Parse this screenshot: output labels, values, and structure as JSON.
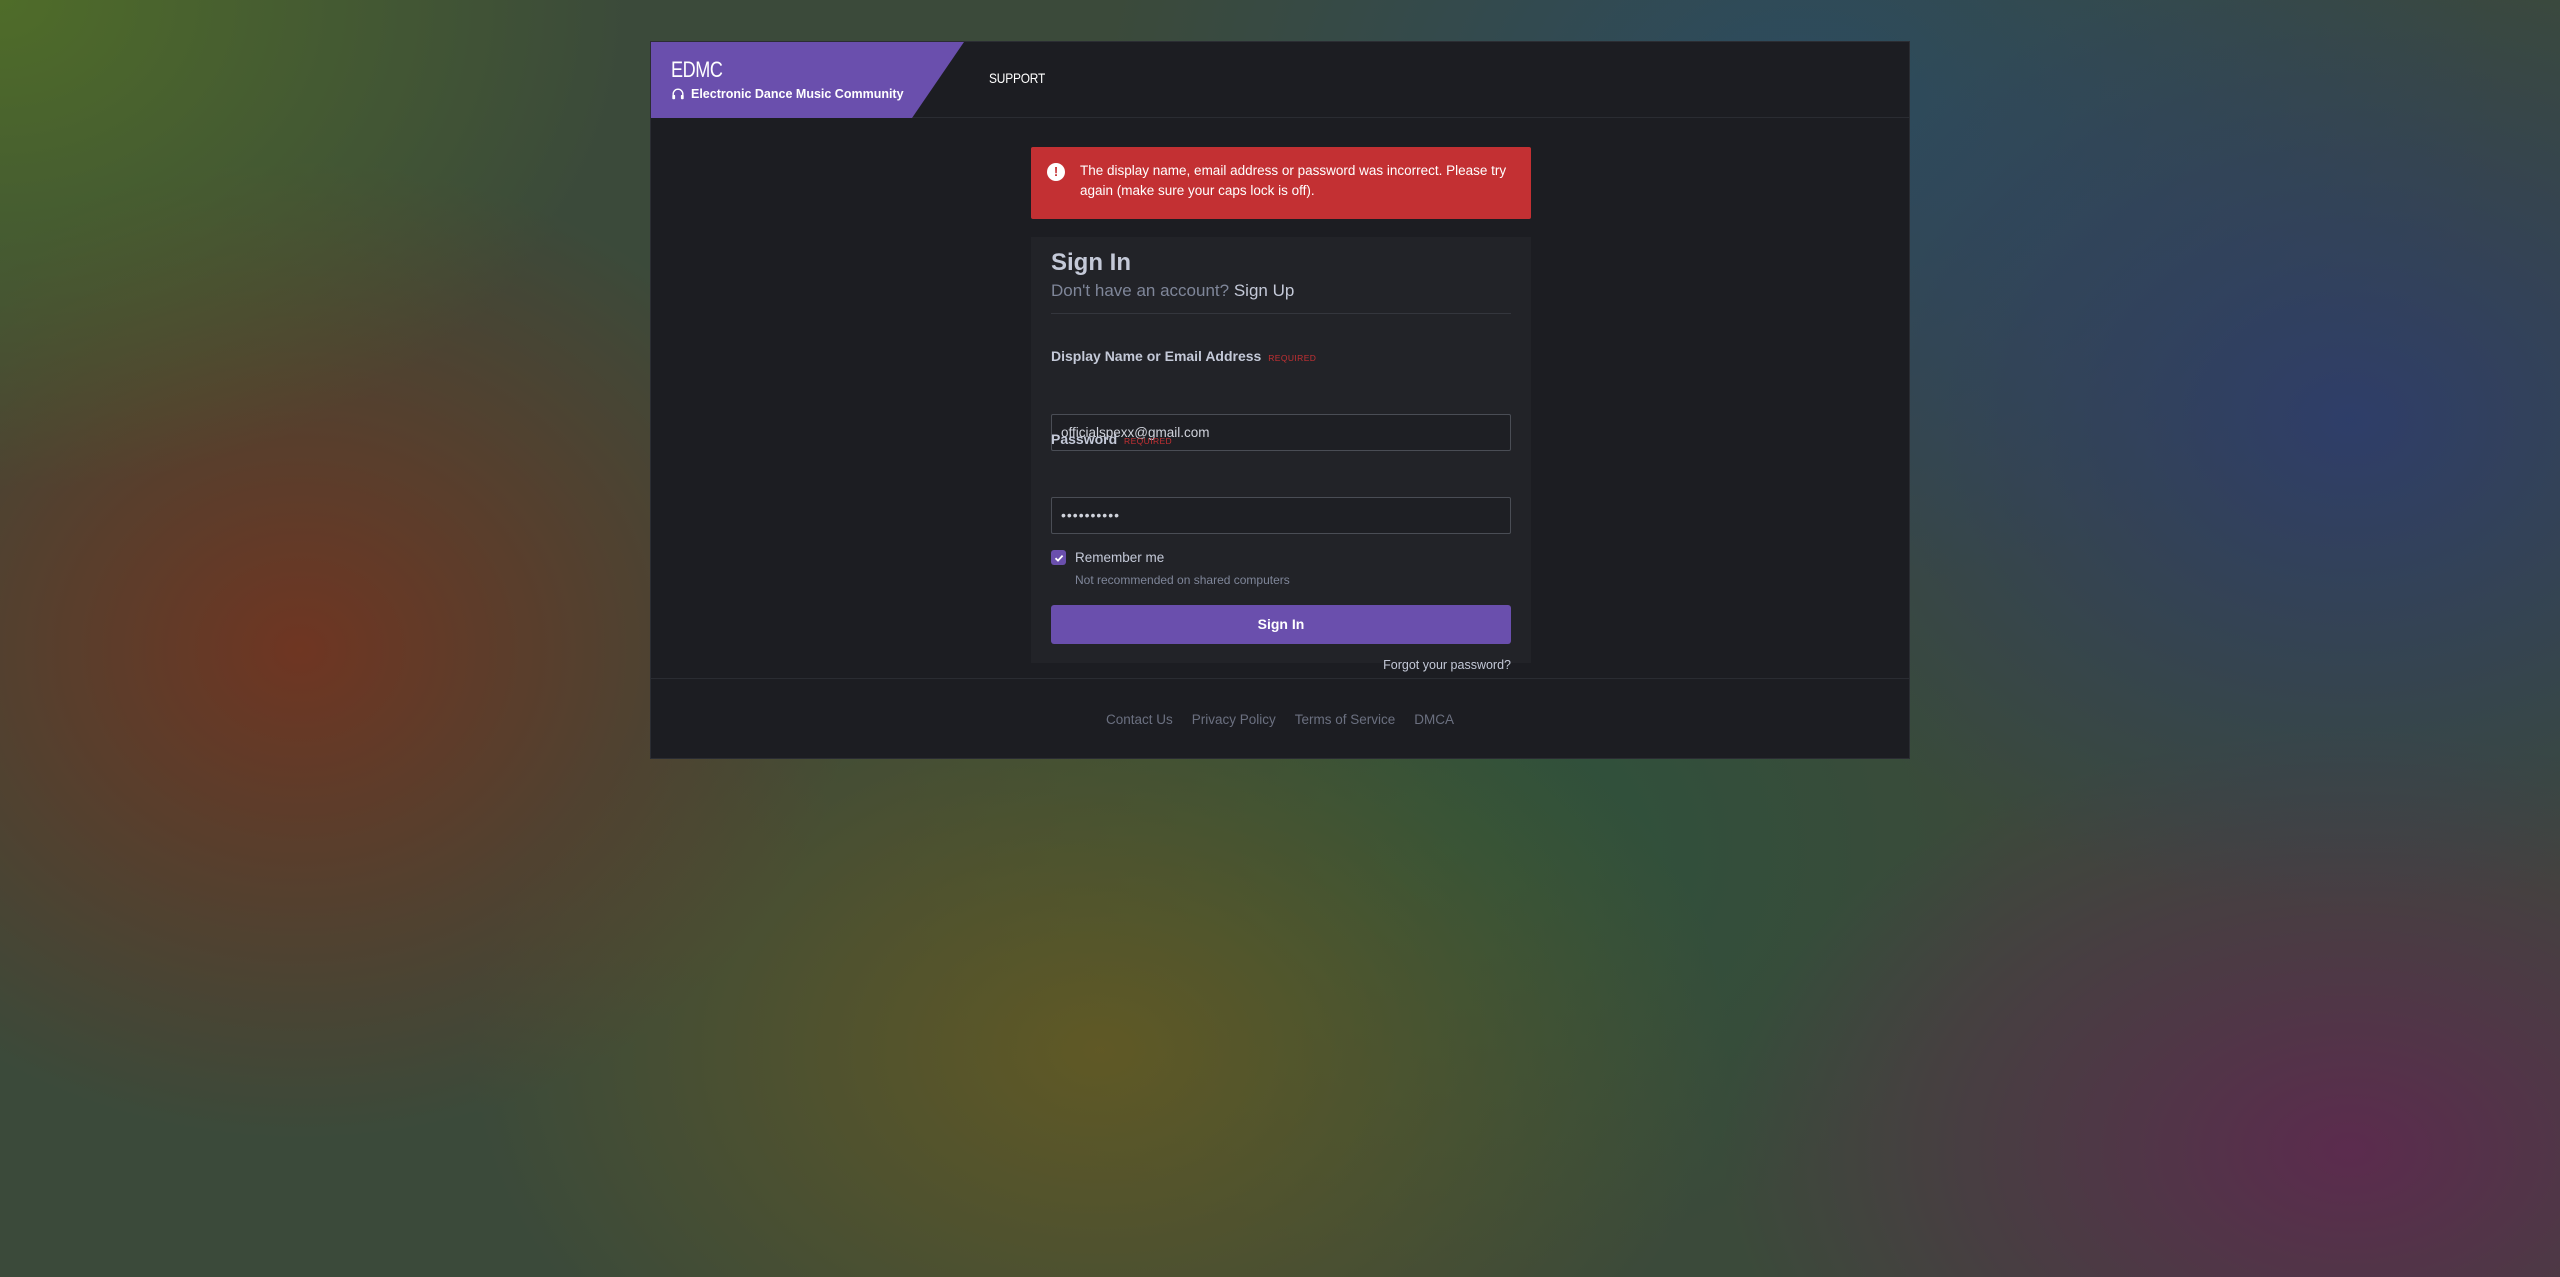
{
  "header": {
    "brand_name": "EDMC",
    "brand_subtitle": "Electronic Dance Music Community",
    "brand_icon": "headphones-icon",
    "nav_support": "SUPPORT"
  },
  "alert": {
    "icon": "exclamation-circle-icon",
    "message": "The display name, email address or password was incorrect. Please try again (make sure your caps lock is off)."
  },
  "form": {
    "title": "Sign In",
    "no_account_text": "Don't have an account?",
    "sign_up_link": "Sign Up",
    "username_label": "Display Name or Email Address",
    "required_tag": "REQUIRED",
    "username_value": "officialspexx@gmail.com",
    "password_label": "Password",
    "password_value": "••••••••••",
    "remember_label": "Remember me",
    "remember_checked": true,
    "remember_hint": "Not recommended on shared computers",
    "submit_label": "Sign In",
    "forgot_link": "Forgot your password?"
  },
  "footer": {
    "links": [
      "Contact Us",
      "Privacy Policy",
      "Terms of Service",
      "DMCA"
    ]
  },
  "colors": {
    "brand": "#6a4fad",
    "error": "#c33033",
    "panel": "#1c1d22"
  }
}
